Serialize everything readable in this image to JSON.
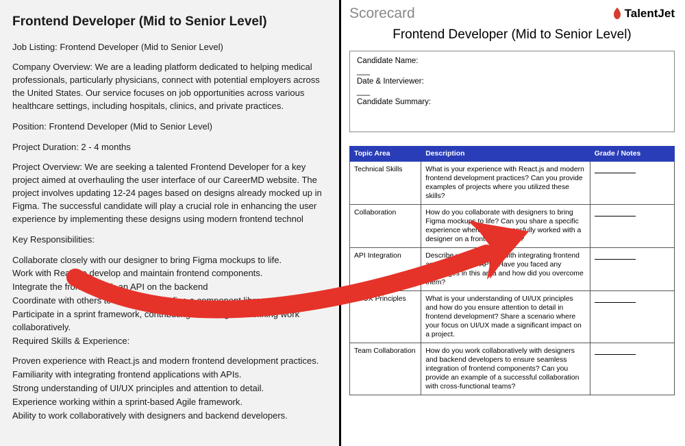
{
  "left": {
    "title": "Frontend Developer (Mid to Senior Level)",
    "listing_line": "Job Listing: Frontend Developer (Mid to Senior Level)",
    "company_overview": "Company Overview: We are a leading platform dedicated to helping medical professionals, particularly physicians, connect with potential employers across the United States. Our service focuses on job opportunities across various healthcare settings, including hospitals, clinics, and private practices.",
    "position": "Position: Frontend Developer (Mid to Senior Level)",
    "duration": "Project Duration: 2 - 4 months",
    "project_overview": "Project Overview: We are seeking a talented Frontend Developer for a key project aimed at overhauling the user interface of our CareerMD website. The project involves updating 12-24 pages based on designs already mocked up in Figma. The successful candidate will play a crucial role in enhancing the user experience by implementing these designs using modern frontend technol",
    "kr_heading": "Key Responsibilities:",
    "kr": [
      "Collaborate closely with our designer to bring Figma mockups to life.",
      "Work with React to develop and maintain frontend components.",
      "Integrate the frontend with an API on the backend",
      "Coordinate with others to develop and refine a component library.",
      "Participate in a sprint framework, contributing to testing and refining work collaboratively."
    ],
    "req_heading": "Required Skills & Experience:",
    "req": [
      "Proven experience with React.js and modern frontend development practices.",
      "Familiarity with integrating frontend applications with APIs.",
      "Strong understanding of UI/UX principles and attention to detail.",
      "Experience working within a sprint-based Agile framework.",
      "Ability to work collaboratively with designers and backend developers."
    ]
  },
  "right": {
    "brand_left": "Scorecard",
    "brand_right": "TalentJet",
    "title": "Frontend Developer (Mid to Senior Level)",
    "fields": {
      "name_label": "Candidate Name:",
      "date_label": "Date & Interviewer:",
      "summary_label": "Candidate Summary:"
    },
    "blank": "___",
    "table": {
      "headers": {
        "topic": "Topic Area",
        "desc": "Description",
        "grade": "Grade / Notes"
      },
      "rows": [
        {
          "topic": "Technical Skills",
          "desc": "What is your experience with React.js and modern frontend development practices? Can you provide examples of projects where you utilized these skills?"
        },
        {
          "topic": "Collaboration",
          "desc": "How do you collaborate with designers to bring Figma mockups to life? Can you share a specific experience where you successfully worked with a designer on a frontend project?"
        },
        {
          "topic": "API Integration",
          "desc": "Describe your familiarity with integrating frontend applications with APIs. Have you faced any challenges in this area and how did you overcome them?"
        },
        {
          "topic": "UI/UX Principles",
          "desc": "What is your understanding of UI/UX principles and how do you ensure attention to detail in frontend development? Share a scenario where your focus on UI/UX made a significant impact on a project."
        },
        {
          "topic": "Team Collaboration",
          "desc": "How do you work collaboratively with designers and backend developers to ensure seamless integration of frontend components? Can you provide an example of a successful collaboration with cross-functional teams?"
        }
      ]
    }
  },
  "arrow": {
    "color": "#e5332a"
  }
}
